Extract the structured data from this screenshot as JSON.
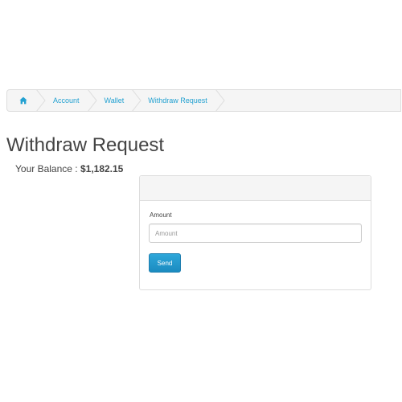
{
  "breadcrumb": {
    "home_icon": "home-icon",
    "items": [
      {
        "label": "Account"
      },
      {
        "label": "Wallet"
      },
      {
        "label": "Withdraw Request"
      }
    ]
  },
  "page": {
    "title": "Withdraw Request",
    "balance_label": "Your Balance :",
    "balance_amount": "$1,182.15"
  },
  "form": {
    "amount_label": "Amount",
    "amount_value": "",
    "amount_placeholder": "Amount",
    "send_label": "Send"
  },
  "colors": {
    "link": "#23a1d1",
    "button": "#1b8bc0"
  }
}
